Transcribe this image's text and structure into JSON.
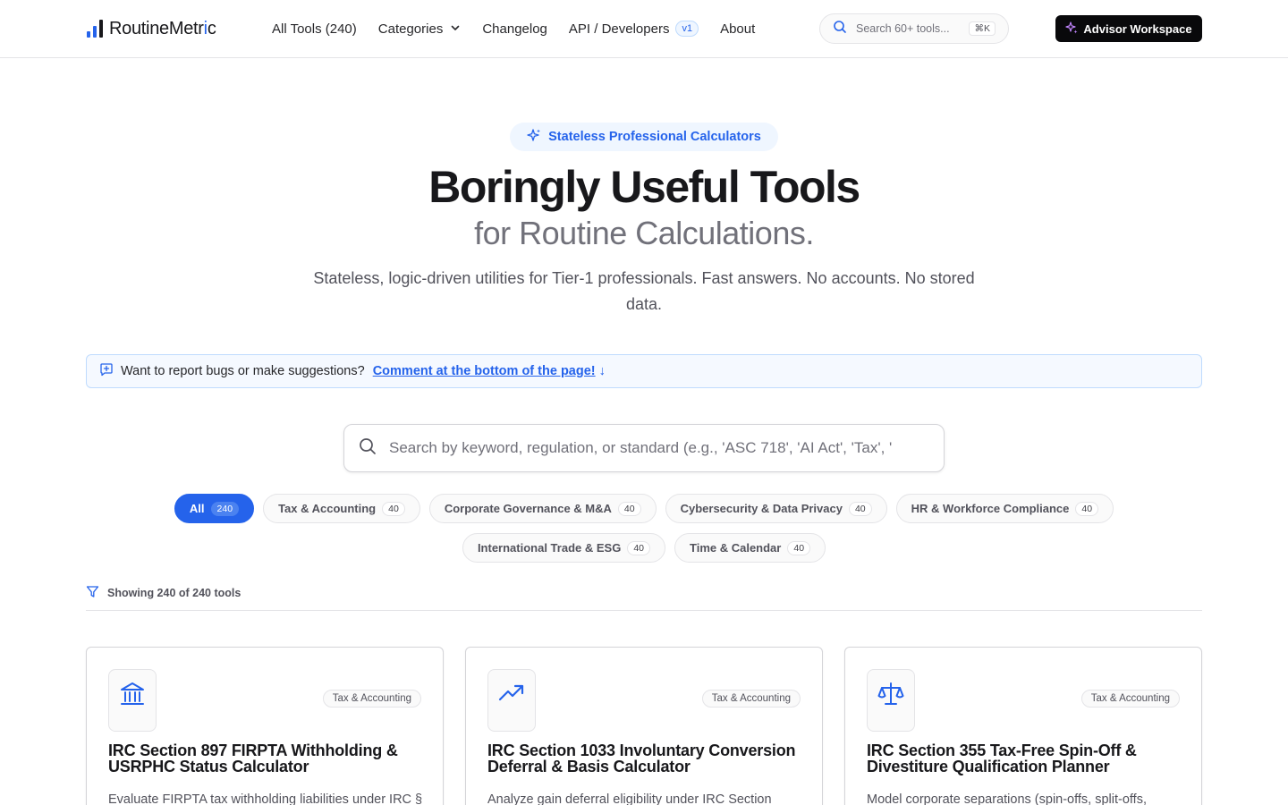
{
  "brand": {
    "name_part1": "Routine",
    "name_part2": "Metr",
    "name_accent": "i",
    "name_part3": "c"
  },
  "nav": {
    "links": [
      {
        "label": "All Tools (240)"
      },
      {
        "label": "Categories"
      },
      {
        "label": "Changelog"
      },
      {
        "label": "API / Developers"
      },
      {
        "label": "About"
      }
    ],
    "api_badge": "v1",
    "search_placeholder": "Search 60+ tools...",
    "search_shortcut": "⌘K",
    "cta_label": "Advisor Workspace"
  },
  "hero": {
    "pill": "Stateless Professional Calculators",
    "title": "Boringly Useful Tools",
    "subtitle": "for Routine Calculations.",
    "lead": "Stateless, logic-driven utilities for Tier-1 professionals. Fast answers. No accounts. No stored data."
  },
  "banner": {
    "message": "Want to report bugs or make suggestions?",
    "link": "Comment at the bottom of the page!",
    "arrow": "↓"
  },
  "search": {
    "placeholder": "Search by keyword, regulation, or standard (e.g., 'ASC 718', 'AI Act', 'Tax', '"
  },
  "filters": [
    {
      "label": "All",
      "count": "240",
      "active": true
    },
    {
      "label": "Tax & Accounting",
      "count": "40"
    },
    {
      "label": "Corporate Governance & M&A",
      "count": "40"
    },
    {
      "label": "Cybersecurity & Data Privacy",
      "count": "40"
    },
    {
      "label": "HR & Workforce Compliance",
      "count": "40"
    },
    {
      "label": "International Trade & ESG",
      "count": "40"
    },
    {
      "label": "Time & Calendar",
      "count": "40"
    }
  ],
  "showing": "Showing 240 of 240 tools",
  "cards": [
    {
      "icon": "bank-icon",
      "tag": "Tax & Accounting",
      "title": "IRC Section 897 FIRPTA Withholding & USRPHC Status Calculator",
      "desc": "Evaluate FIRPTA tax withholding liabilities under IRC §"
    },
    {
      "icon": "trending-up-icon",
      "tag": "Tax & Accounting",
      "title": "IRC Section 1033 Involuntary Conversion Deferral & Basis Calculator",
      "desc": "Analyze gain deferral eligibility under IRC Section"
    },
    {
      "icon": "scale-icon",
      "tag": "Tax & Accounting",
      "title": "IRC Section 355 Tax-Free Spin-Off & Divestiture Qualification Planner",
      "desc": "Model corporate separations (spin-offs, split-offs,"
    }
  ],
  "colors": {
    "accent": "#2563eb",
    "dark": "#09090b",
    "muted": "#71717a"
  }
}
